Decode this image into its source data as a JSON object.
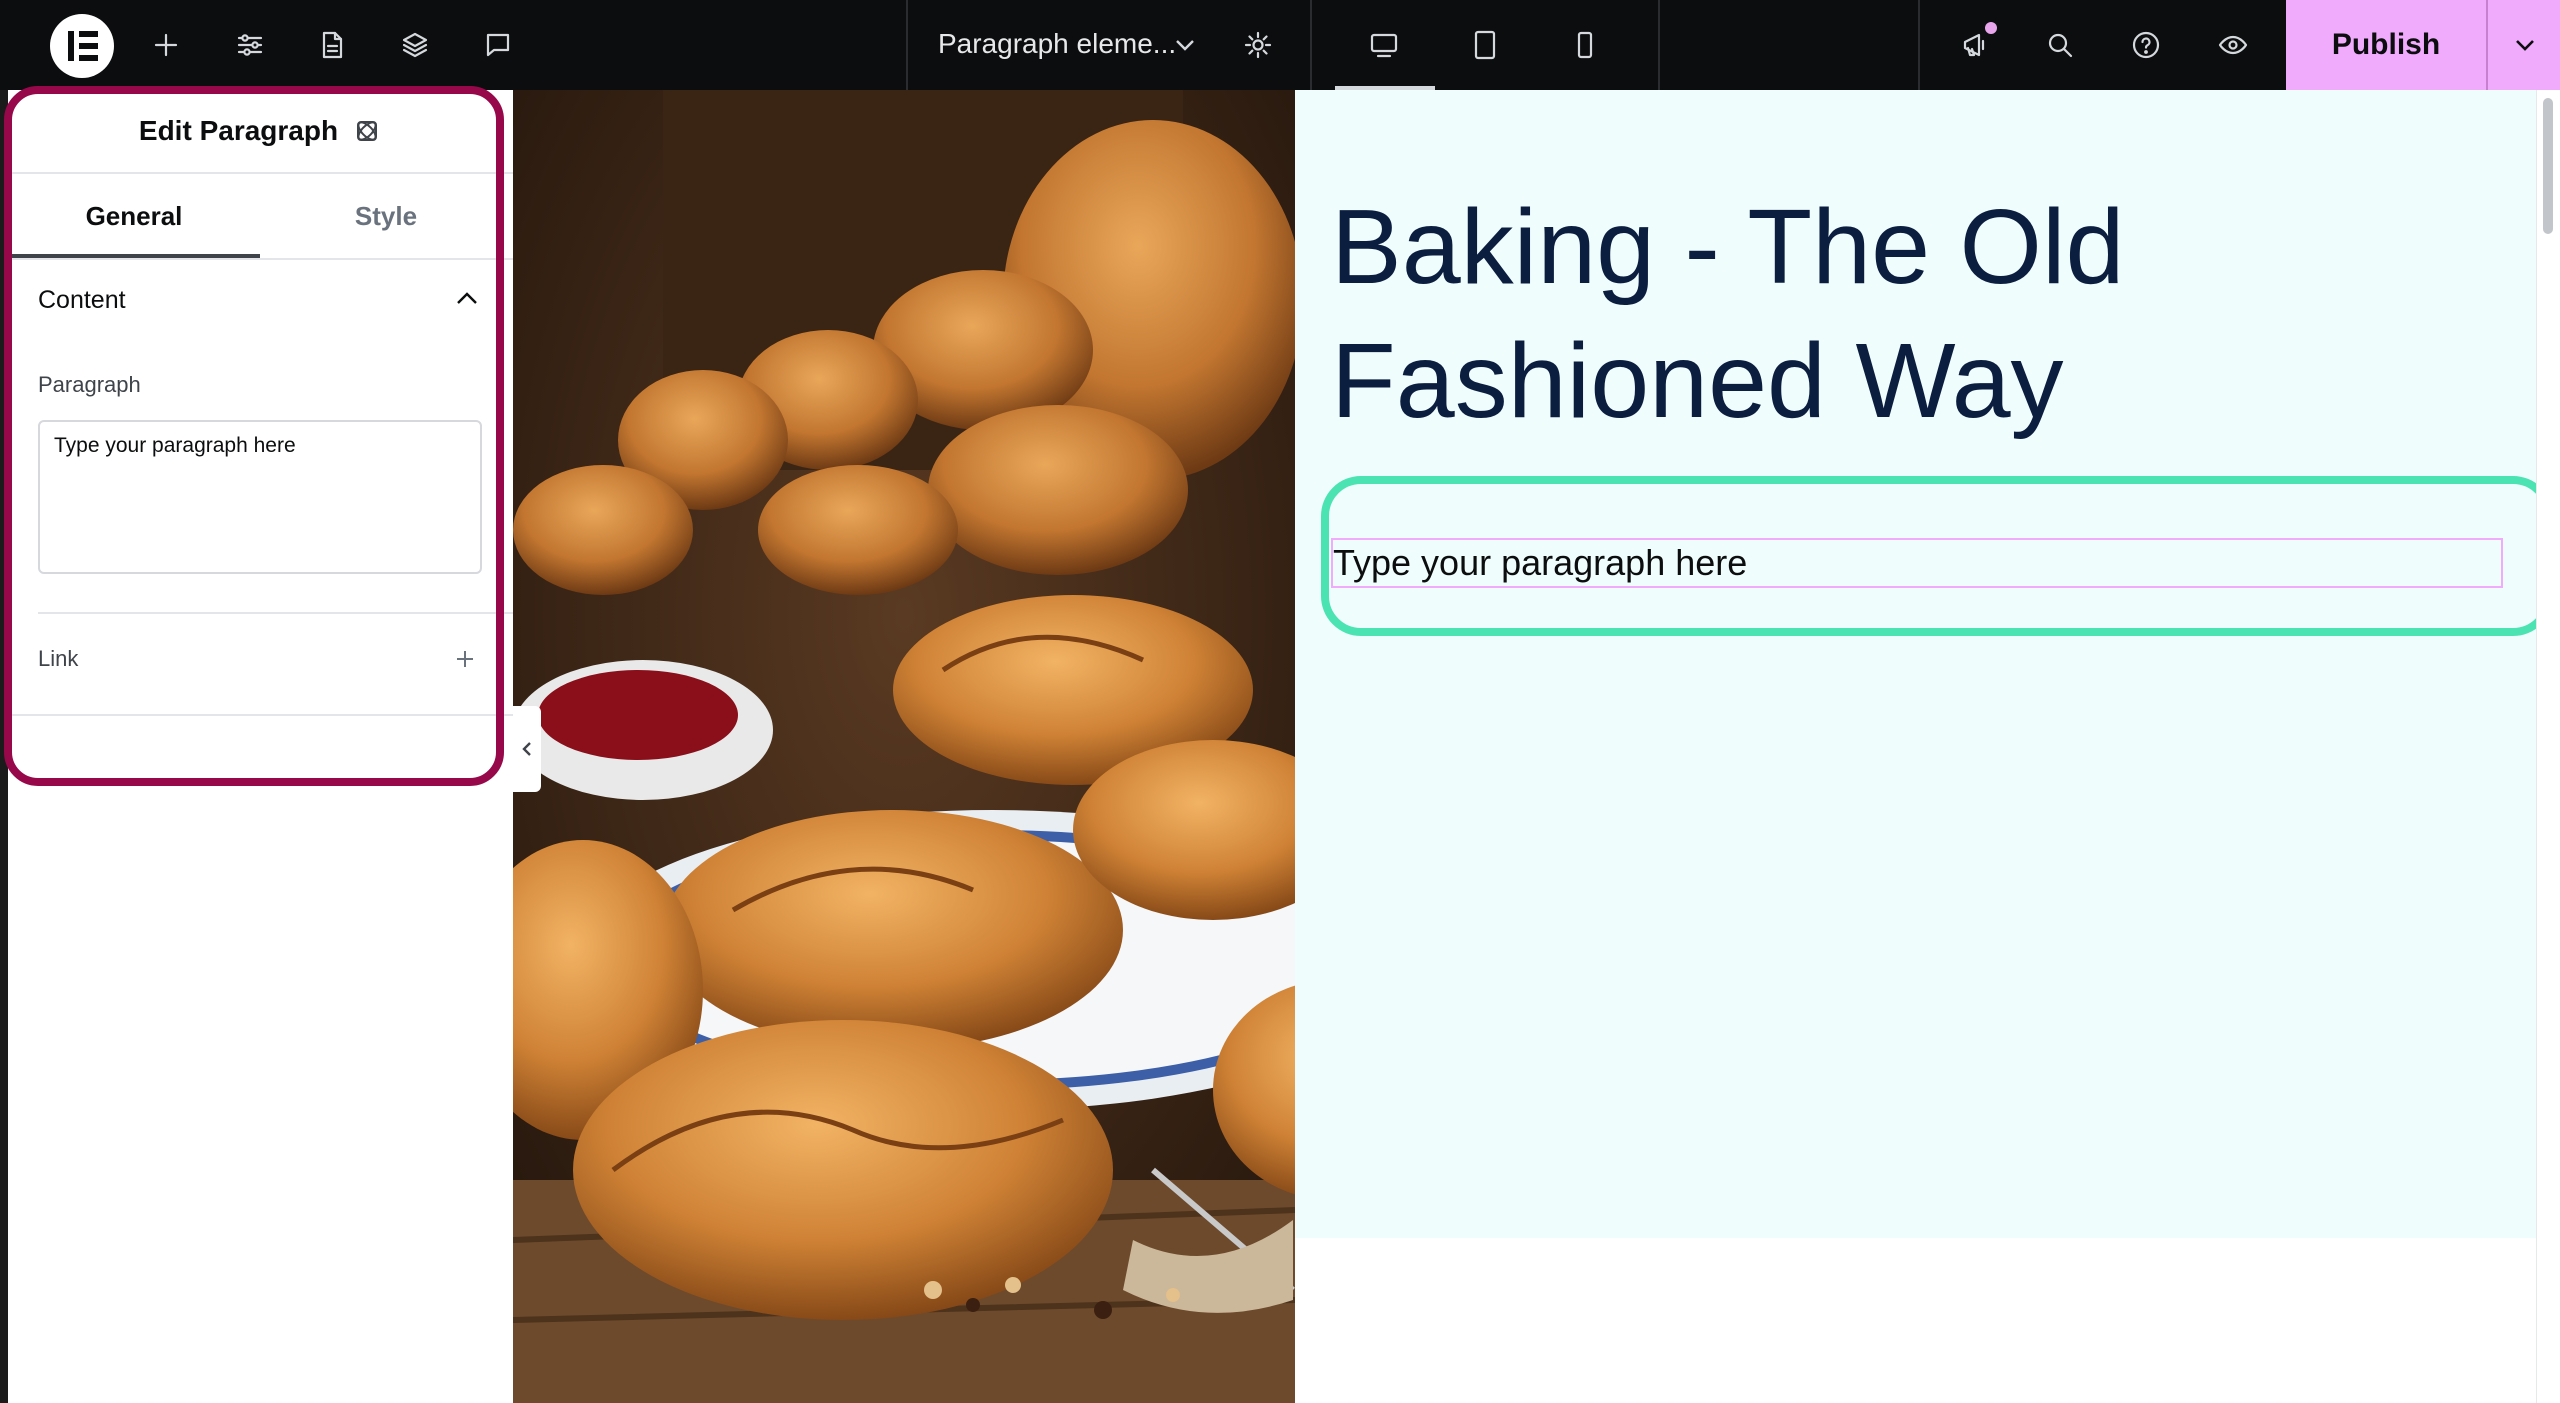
{
  "topbar": {
    "page_title": "Paragraph eleme...",
    "publish_label": "Publish",
    "icons": [
      "elementor-logo-icon",
      "add-icon",
      "site-settings-icon",
      "page-icon",
      "layers-icon",
      "comments-icon",
      "chevron-down-icon",
      "settings-gear-icon",
      "desktop-icon",
      "tablet-icon",
      "mobile-icon",
      "whats-new-icon",
      "search-icon",
      "help-icon",
      "preview-eye-icon"
    ],
    "notification_dot_color": "#e8a5ec",
    "publish_color": "#f0abfc"
  },
  "panel": {
    "title": "Edit Paragraph",
    "tabs": [
      {
        "label": "General",
        "active": true
      },
      {
        "label": "Style",
        "active": false
      }
    ],
    "section": {
      "label": "Content",
      "expanded": true
    },
    "fields": {
      "paragraph_label": "Paragraph",
      "paragraph_value": "Type your paragraph here",
      "link_label": "Link"
    },
    "highlight_color": "#97084a"
  },
  "canvas": {
    "heading": "Baking - The Old Fashioned Way",
    "paragraph": "Type your paragraph here",
    "paragraph_highlight_color": "#4be3b2",
    "hero_background": "#f0fdfd"
  }
}
